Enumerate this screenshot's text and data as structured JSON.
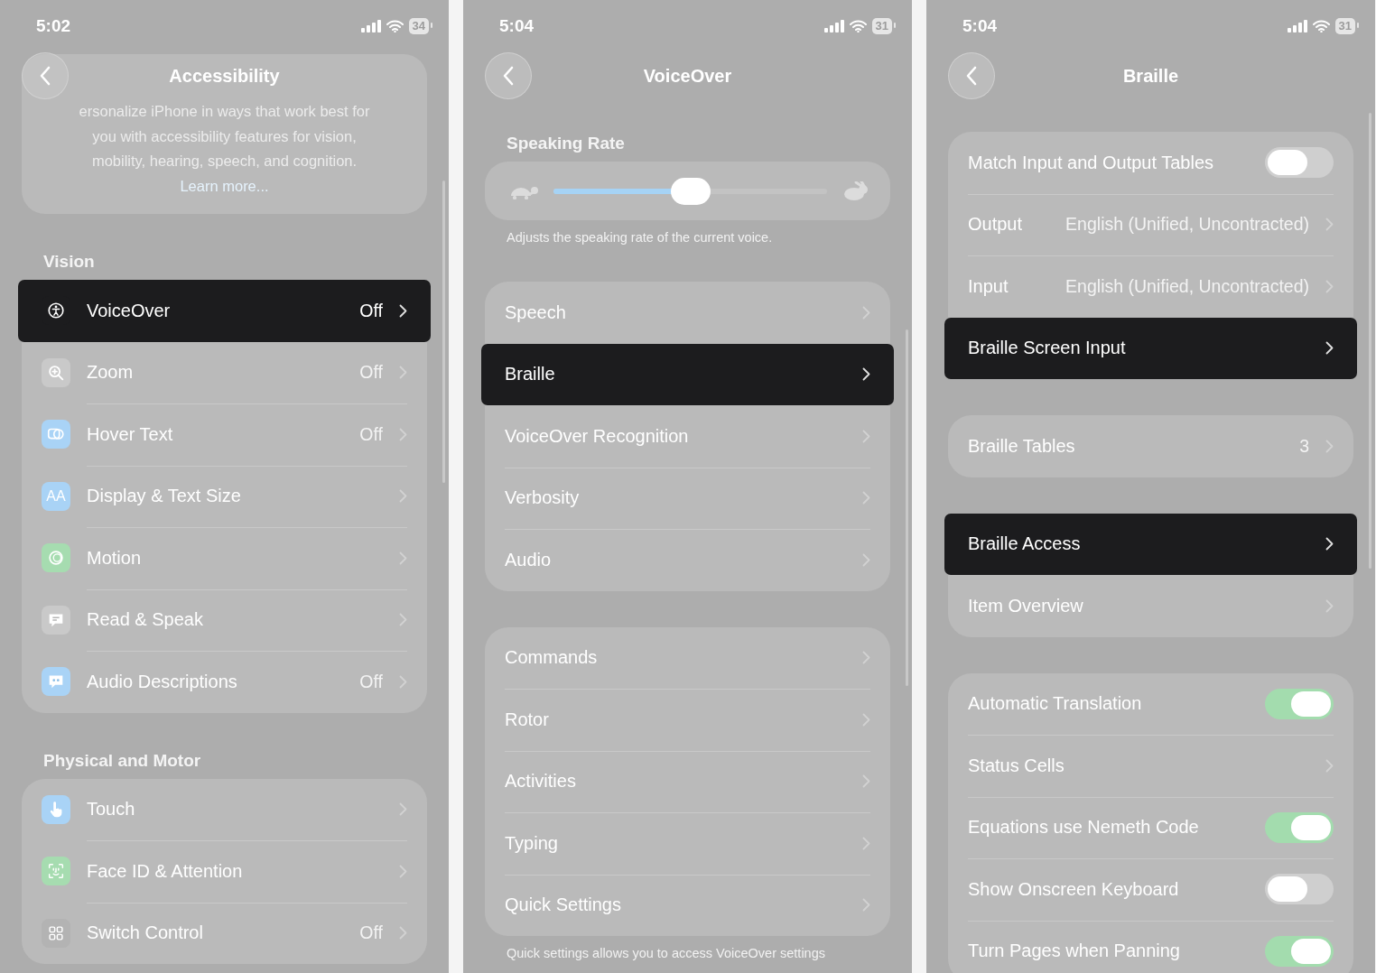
{
  "screens": [
    {
      "time": "5:02",
      "battery": "34",
      "title": "Accessibility",
      "sections": [
        {
          "kind": "about",
          "lines": [
            "ersonalize iPhone in ways that work best for",
            "you with accessibility features for vision,",
            "mobility, hearing, speech, and cognition."
          ],
          "link": "Learn more..."
        },
        {
          "kind": "list",
          "header": "Vision",
          "rows": [
            {
              "kind": "link",
              "label": "VoiceOver",
              "value": "Off",
              "highlighted": true,
              "color": "#1c1c1e"
            },
            {
              "kind": "link",
              "label": "Zoom",
              "value": "Off",
              "highlighted": false,
              "color": "#c9c9c9"
            },
            {
              "kind": "link",
              "label": "Hover Text",
              "value": "Off",
              "highlighted": false,
              "color": "#a9d3f6"
            },
            {
              "kind": "link",
              "label": "Display & Text Size",
              "highlighted": false,
              "color": "#a9d3f6",
              "icon_text": "AA"
            },
            {
              "kind": "link",
              "label": "Motion",
              "highlighted": false,
              "color": "#a6dcb0"
            },
            {
              "kind": "link",
              "label": "Read & Speak",
              "highlighted": false,
              "color": "#c9c9c9"
            },
            {
              "kind": "link",
              "label": "Audio Descriptions",
              "value": "Off",
              "highlighted": false,
              "color": "#a9d3f6"
            }
          ]
        },
        {
          "kind": "list",
          "header": "Physical and Motor",
          "rows": [
            {
              "kind": "link",
              "label": "Touch",
              "highlighted": false,
              "color": "#a9d3f6"
            },
            {
              "kind": "link",
              "label": "Face ID & Attention",
              "highlighted": false,
              "color": "#a6dcb0"
            },
            {
              "kind": "link",
              "label": "Switch Control",
              "value": "Off",
              "highlighted": false,
              "color": "#b3b3b3"
            }
          ]
        }
      ]
    },
    {
      "time": "5:04",
      "battery": "31",
      "title": "VoiceOver",
      "sections": [
        {
          "kind": "slider",
          "header": "Speaking Rate",
          "level": 0.5,
          "footer": "Adjusts the speaking rate of the current voice."
        },
        {
          "kind": "list",
          "rows": [
            {
              "kind": "link",
              "label": "Speech",
              "highlighted": false
            },
            {
              "kind": "link",
              "label": "Braille",
              "highlighted": true
            },
            {
              "kind": "link",
              "label": "VoiceOver Recognition",
              "highlighted": false
            },
            {
              "kind": "link",
              "label": "Verbosity",
              "highlighted": false
            },
            {
              "kind": "link",
              "label": "Audio",
              "highlighted": false
            }
          ]
        },
        {
          "kind": "list",
          "footer": "Quick settings allows you to access VoiceOver settings",
          "rows": [
            {
              "kind": "link",
              "label": "Commands",
              "highlighted": false
            },
            {
              "kind": "link",
              "label": "Rotor",
              "highlighted": false
            },
            {
              "kind": "link",
              "label": "Activities",
              "highlighted": false
            },
            {
              "kind": "link",
              "label": "Typing",
              "highlighted": false
            },
            {
              "kind": "link",
              "label": "Quick Settings",
              "highlighted": false
            }
          ]
        }
      ]
    },
    {
      "time": "5:04",
      "battery": "31",
      "title": "Braille",
      "sections": [
        {
          "kind": "list",
          "rows": [
            {
              "kind": "toggle",
              "label": "Match Input and Output Tables",
              "on": false,
              "highlighted": false
            },
            {
              "kind": "link",
              "label": "Output",
              "value": "English (Unified, Uncontracted)",
              "highlighted": false
            },
            {
              "kind": "link",
              "label": "Input",
              "value": "English (Unified, Uncontracted)",
              "highlighted": false
            },
            {
              "kind": "link",
              "label": "Braille Screen Input",
              "highlighted": true
            }
          ]
        },
        {
          "kind": "list",
          "rows": [
            {
              "kind": "link",
              "label": "Braille Tables",
              "value": "3",
              "highlighted": false
            }
          ]
        },
        {
          "kind": "list",
          "rows": [
            {
              "kind": "link",
              "label": "Braille Access",
              "highlighted": true
            },
            {
              "kind": "link",
              "label": "Item Overview",
              "highlighted": false
            }
          ]
        },
        {
          "kind": "list",
          "rows": [
            {
              "kind": "toggle",
              "label": "Automatic Translation",
              "on": true,
              "highlighted": false
            },
            {
              "kind": "link",
              "label": "Status Cells",
              "highlighted": false
            },
            {
              "kind": "toggle",
              "label": "Equations use Nemeth Code",
              "on": true,
              "highlighted": false
            },
            {
              "kind": "toggle",
              "label": "Show Onscreen Keyboard",
              "on": false,
              "highlighted": false
            },
            {
              "kind": "toggle",
              "label": "Turn Pages when Panning",
              "on": true,
              "highlighted": false
            }
          ]
        }
      ]
    }
  ]
}
